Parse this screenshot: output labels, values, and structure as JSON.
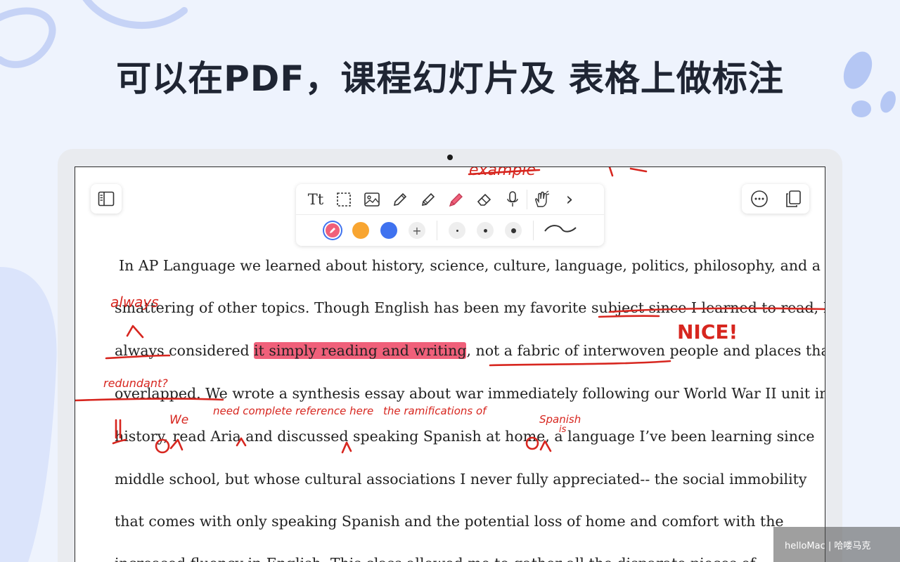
{
  "headline": "可以在PDF，课程幻灯片及 表格上做标注",
  "toolbar": {
    "tools": [
      "text-tool",
      "selection-tool",
      "image-tool",
      "pen-tool",
      "pencil-tool",
      "highlighter-tool",
      "eraser-tool",
      "microphone-tool",
      "gesture-tool",
      "more-tools"
    ],
    "text_tool_label": "Tt",
    "more_arrow": "›",
    "colors": [
      "#f0607a",
      "#f8a531",
      "#3f72ef"
    ],
    "add_color": "+",
    "stroke_sizes": [
      "small",
      "medium",
      "large"
    ]
  },
  "left_panel_icon": "sidebar-icon",
  "right_icons": [
    "more-options-icon",
    "pages-icon"
  ],
  "document": {
    "lines": [
      "In AP Language we learned about history, science, culture, language, politics, philosophy, and a",
      "smattering of other topics. Though English has been my favorite subject since I learned to read, I",
      "always considered ",
      "it simply reading and writing",
      ", not a fabric of interwoven people and places that",
      "overlapped. We wrote a synthesis essay about war immediately following our World War II unit in",
      "history, read Aria and discussed speaking Spanish at home, a language I’ve been learning since",
      "middle school, but whose cultural associations I never fully appreciated-- the social immobility",
      "that comes with only speaking Spanish and the potential loss of home and comfort with the",
      "increased fluency in English. This class allowed me to gather all the disparate pieces of"
    ]
  },
  "annotations": {
    "always": "always",
    "nice": "NICE!",
    "redundant": "redundant?",
    "need_ref": "need complete reference here",
    "ramifications": "the ramifications of",
    "we": "We",
    "spanish": "Spanish",
    "is": "is",
    "top_example": "example"
  },
  "watermark": "helloMac | 哈喽马克"
}
